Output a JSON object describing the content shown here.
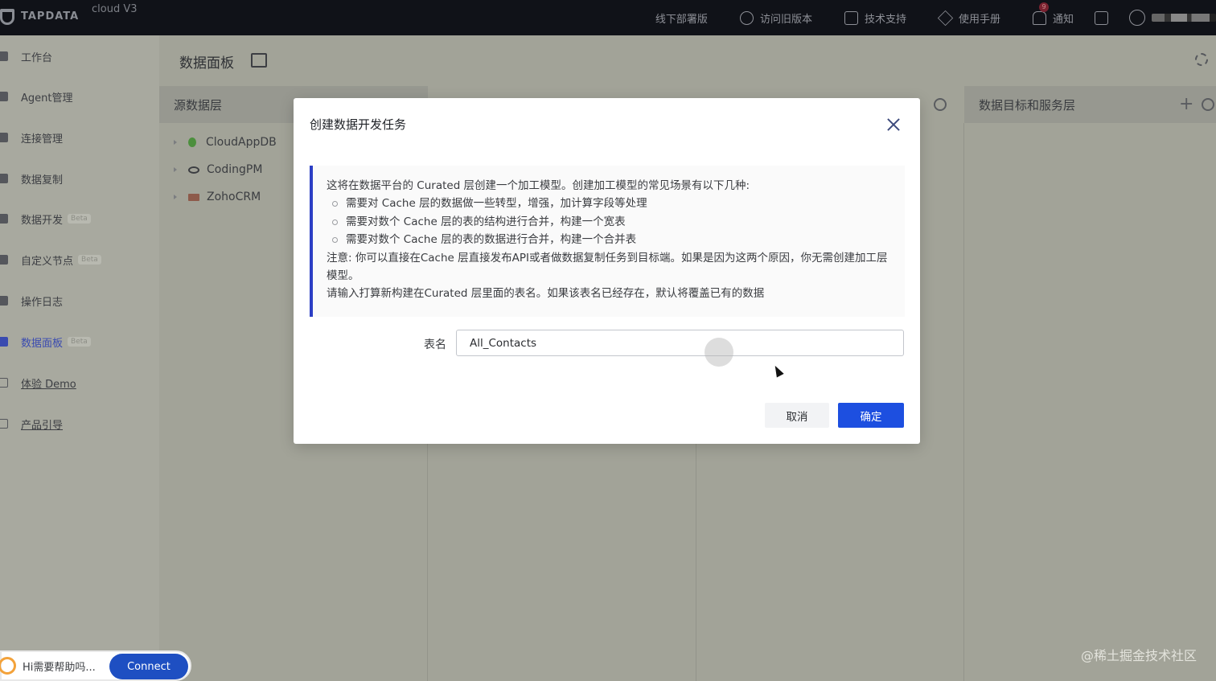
{
  "topbar": {
    "logo_text": "TAPDATA",
    "logo_sub": "cloud V3",
    "nav": [
      {
        "label": "线下部署版",
        "icon": ""
      },
      {
        "label": "访问旧版本",
        "icon": "history-icon"
      },
      {
        "label": "技术支持",
        "icon": "support-icon"
      },
      {
        "label": "使用手册",
        "icon": "manual-icon"
      },
      {
        "label": "通知",
        "icon": "bell-icon",
        "badge": "9"
      }
    ]
  },
  "sidebar": {
    "items": [
      {
        "label": "工作台"
      },
      {
        "label": "Agent管理"
      },
      {
        "label": "连接管理"
      },
      {
        "label": "数据复制"
      },
      {
        "label": "数据开发",
        "badge": "Beta"
      },
      {
        "label": "自定义节点",
        "badge": "Beta"
      },
      {
        "label": "操作日志"
      },
      {
        "label": "数据面板",
        "badge": "Beta",
        "active": true
      },
      {
        "label": "体验 Demo",
        "link": true
      },
      {
        "label": "产品引导",
        "link": true
      }
    ]
  },
  "main": {
    "title": "数据面板",
    "source_header": "源数据层",
    "target_header": "数据目标和服务层",
    "tree": [
      {
        "label": "CloudAppDB",
        "icon": "mongodb-icon"
      },
      {
        "label": "CodingPM",
        "icon": "mysql-icon"
      },
      {
        "label": "ZohoCRM",
        "icon": "zoho-icon"
      }
    ]
  },
  "modal": {
    "title": "创建数据开发任务",
    "intro": "这将在数据平台的 Curated 层创建一个加工模型。创建加工模型的常见场景有以下几种:",
    "bullets": [
      "需要对 Cache 层的数据做一些转型，增强，加计算字段等处理",
      "需要对数个 Cache 层的表的结构进行合并，构建一个宽表",
      "需要对数个 Cache 层的表的数据进行合并，构建一个合并表"
    ],
    "note": "注意: 你可以直接在Cache 层直接发布API或者做数据复制任务到目标端。如果是因为这两个原因，你无需创建加工层模型。",
    "prompt": "请输入打算新构建在Curated 层里面的表名。如果该表名已经存在，默认将覆盖已有的数据",
    "field_label": "表名",
    "field_value": "All_Contacts",
    "cancel_label": "取消",
    "ok_label": "确定"
  },
  "chat": {
    "text": "Hi需要帮助吗...",
    "button": "Connect"
  },
  "watermark": "@稀土掘金技术社区",
  "colors": {
    "primary": "#1d4fe0",
    "topbar_bg": "#101218",
    "info_border": "#2c3fc5"
  }
}
